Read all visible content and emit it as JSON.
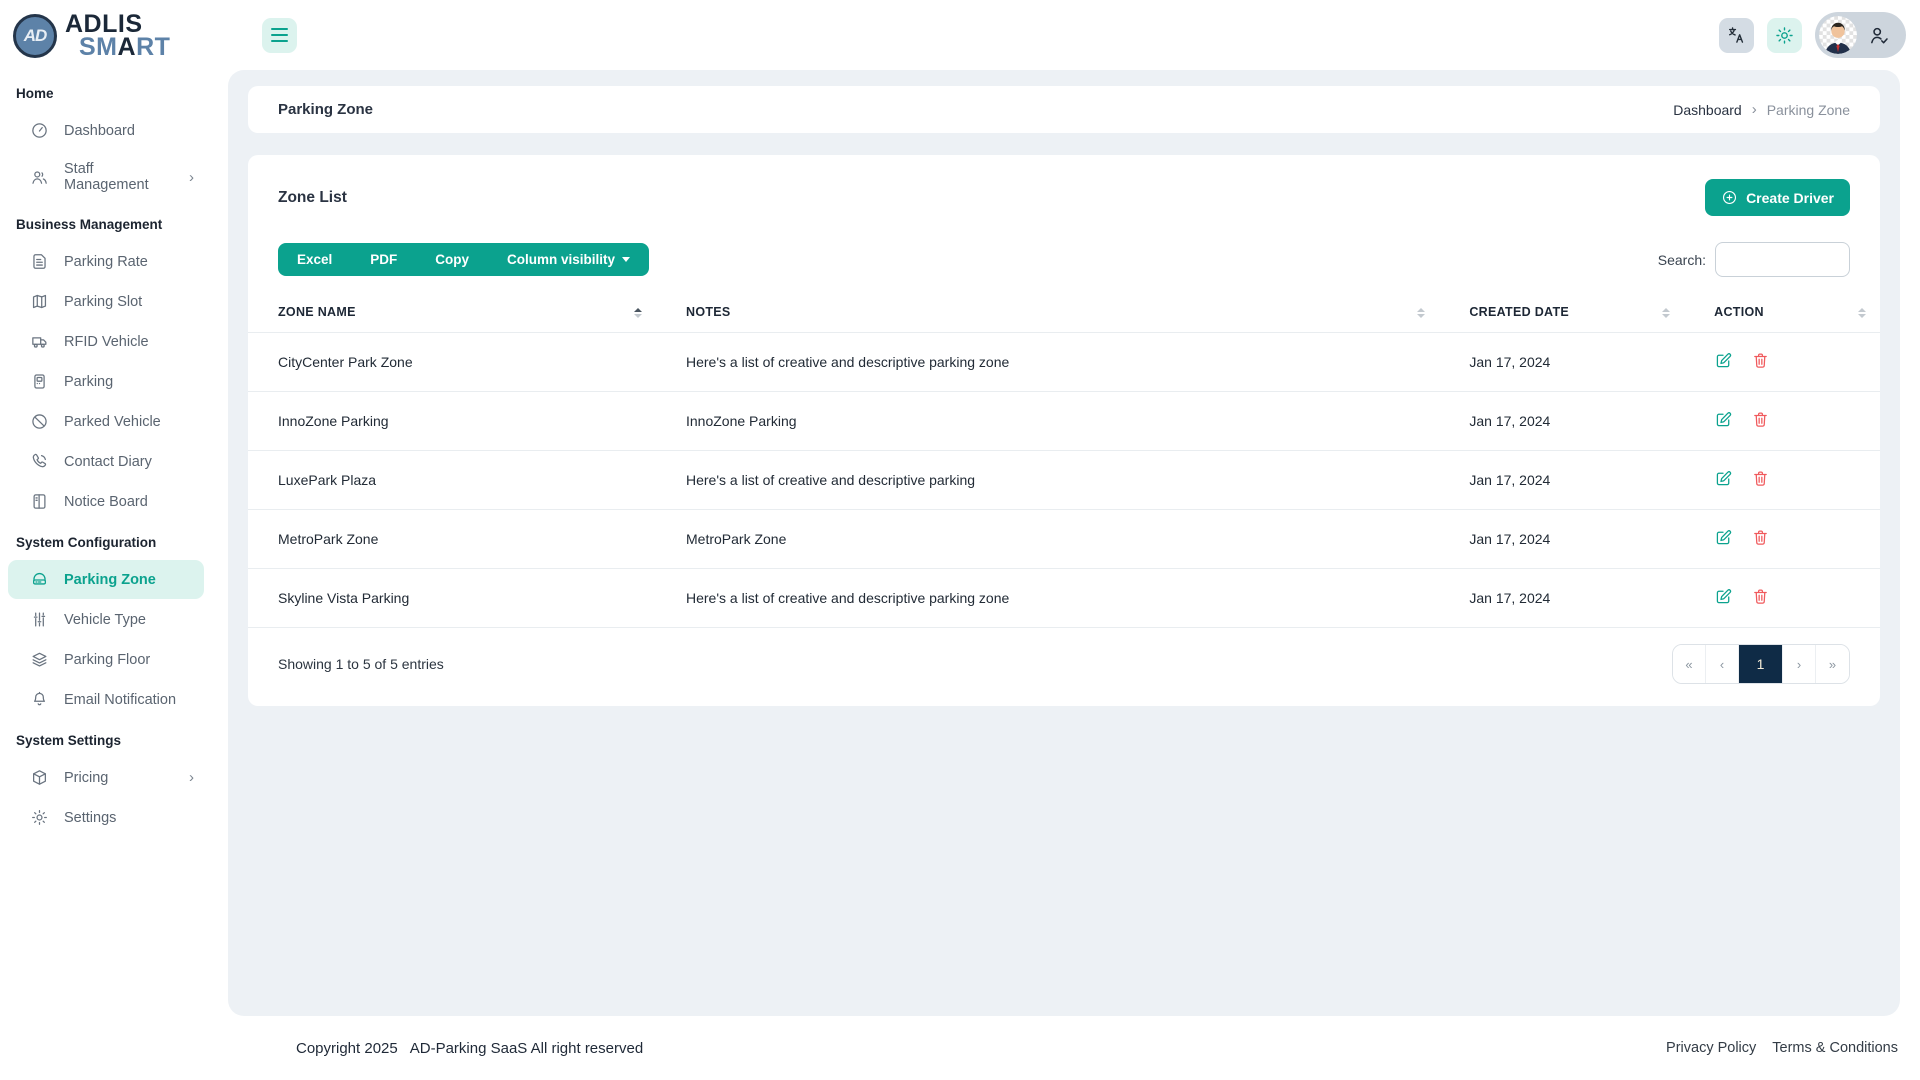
{
  "colors": {
    "accent": "#0ba28e",
    "accent_light": "#dcf3ee",
    "danger": "#f0595c",
    "navy": "#0f2b46",
    "panel_bg": "#edf1f5"
  },
  "brand": {
    "badge": "AD",
    "line1": "ADLIS",
    "line2_a": "SM",
    "line2_b": "A",
    "line2_c": "RT"
  },
  "sidebar": {
    "sections": [
      {
        "label": "Home",
        "items": [
          {
            "label": "Dashboard",
            "icon": "speedometer"
          },
          {
            "label": "Staff Management",
            "icon": "people",
            "chevron": "›"
          }
        ]
      },
      {
        "label": "Business Management",
        "items": [
          {
            "label": "Parking Rate",
            "icon": "document"
          },
          {
            "label": "Parking Slot",
            "icon": "map"
          },
          {
            "label": "RFID Vehicle",
            "icon": "truck"
          },
          {
            "label": "Parking",
            "icon": "meter"
          },
          {
            "label": "Parked Vehicle",
            "icon": "slash-circle"
          },
          {
            "label": "Contact Diary",
            "icon": "phone"
          },
          {
            "label": "Notice Board",
            "icon": "journal"
          }
        ]
      },
      {
        "label": "System Configuration",
        "items": [
          {
            "label": "Parking Zone",
            "icon": "car",
            "active": true
          },
          {
            "label": "Vehicle Type",
            "icon": "sliders"
          },
          {
            "label": "Parking Floor",
            "icon": "layers"
          },
          {
            "label": "Email Notification",
            "icon": "bell"
          }
        ]
      },
      {
        "label": "System Settings",
        "items": [
          {
            "label": "Pricing",
            "icon": "box",
            "chevron": "›"
          },
          {
            "label": "Settings",
            "icon": "gear"
          }
        ]
      }
    ]
  },
  "page": {
    "title": "Parking Zone",
    "breadcrumb": {
      "home": "Dashboard",
      "separator": "›",
      "current": "Parking Zone"
    }
  },
  "zone_card": {
    "title": "Zone List",
    "create_button": "Create Driver",
    "export_buttons": [
      "Excel",
      "PDF",
      "Copy"
    ],
    "column_visibility": "Column visibility",
    "search_label": "Search:",
    "search_value": ""
  },
  "table": {
    "columns": [
      {
        "label": "ZONE NAME",
        "sort": "asc"
      },
      {
        "label": "NOTES",
        "sort": "none"
      },
      {
        "label": "CREATED DATE",
        "sort": "none"
      },
      {
        "label": "ACTION",
        "sort": "none"
      }
    ],
    "rows": [
      {
        "zone": "CityCenter Park Zone",
        "notes": "Here's a list of creative and descriptive parking zone",
        "date": "Jan 17, 2024"
      },
      {
        "zone": "InnoZone Parking",
        "notes": "InnoZone Parking",
        "date": "Jan 17, 2024"
      },
      {
        "zone": "LuxePark Plaza",
        "notes": "Here's a list of creative and descriptive parking",
        "date": "Jan 17, 2024"
      },
      {
        "zone": "MetroPark Zone",
        "notes": "MetroPark Zone",
        "date": "Jan 17, 2024"
      },
      {
        "zone": "Skyline Vista Parking",
        "notes": "Here's a list of creative and descriptive parking zone",
        "date": "Jan 17, 2024"
      }
    ],
    "summary": "Showing 1 to 5 of 5 entries",
    "pagination": {
      "first": "«",
      "prev": "‹",
      "page": "1",
      "next": "›",
      "last": "»"
    }
  },
  "footer": {
    "copyright": "Copyright 2025",
    "company": "AD-Parking SaaS All right reserved",
    "links": [
      "Privacy Policy",
      "Terms & Conditions"
    ]
  }
}
